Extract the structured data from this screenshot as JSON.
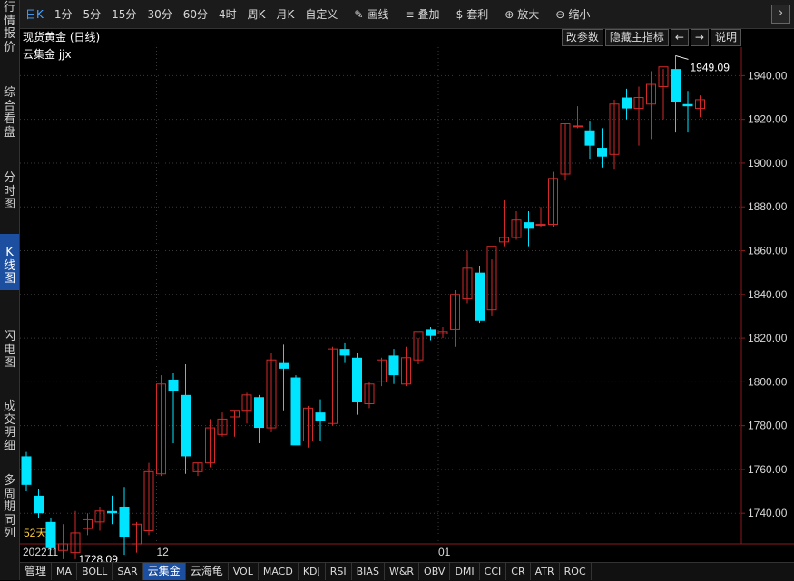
{
  "toolbar": {
    "items": [
      {
        "label": "日K",
        "icon": ""
      },
      {
        "label": "1分",
        "icon": ""
      },
      {
        "label": "5分",
        "icon": ""
      },
      {
        "label": "15分",
        "icon": ""
      },
      {
        "label": "30分",
        "icon": ""
      },
      {
        "label": "60分",
        "icon": ""
      },
      {
        "label": "4时",
        "icon": ""
      },
      {
        "label": "周K",
        "icon": ""
      },
      {
        "label": "月K",
        "icon": ""
      },
      {
        "label": "自定义",
        "icon": ""
      },
      {
        "label": "画线",
        "icon": "✎"
      },
      {
        "label": "叠加",
        "icon": "≡"
      },
      {
        "label": "套利",
        "icon": "$"
      },
      {
        "label": "放大",
        "icon": "⊕"
      },
      {
        "label": "缩小",
        "icon": "⊖"
      }
    ],
    "more_icon": "chevron-right-icon"
  },
  "sidebar": {
    "items": [
      {
        "label": "行情报价"
      },
      {
        "label": "综合看盘"
      },
      {
        "label": "分时图"
      },
      {
        "label": "K线图"
      },
      {
        "label": "闪电图"
      },
      {
        "label": "成交明细"
      },
      {
        "label": "多周期同列"
      }
    ]
  },
  "header": {
    "title": "现货黄金 (日线)",
    "subtitle": "云集金 jjx",
    "buttons": [
      {
        "label": "改参数"
      },
      {
        "label": "隐藏主指标"
      },
      {
        "label": "←"
      },
      {
        "label": "→"
      },
      {
        "label": "说明"
      }
    ]
  },
  "bottom_tabs": [
    {
      "label": "管理"
    },
    {
      "label": "MA"
    },
    {
      "label": "BOLL"
    },
    {
      "label": "SAR"
    },
    {
      "label": "云集金"
    },
    {
      "label": "云海龟"
    },
    {
      "label": "VOL"
    },
    {
      "label": "MACD"
    },
    {
      "label": "KDJ"
    },
    {
      "label": "RSI"
    },
    {
      "label": "BIAS"
    },
    {
      "label": "W&R"
    },
    {
      "label": "OBV"
    },
    {
      "label": "DMI"
    },
    {
      "label": "CCI"
    },
    {
      "label": "CR"
    },
    {
      "label": "ATR"
    },
    {
      "label": "ROC"
    }
  ],
  "colors": {
    "up": "#d42a2a",
    "down": "#00e5ff",
    "axis": "#8a1a1a",
    "grid": "#3a3a3a",
    "active": "#1d4fa0"
  },
  "chart_data": {
    "type": "candlestick",
    "ylim": [
      1726,
      1953
    ],
    "y_ticks": [
      1740,
      1760,
      1780,
      1800,
      1820,
      1840,
      1860,
      1880,
      1900,
      1920,
      1940
    ],
    "x_labels": [
      {
        "index": 0,
        "label": "202211"
      },
      {
        "index": 11,
        "label": "12"
      },
      {
        "index": 34,
        "label": "01"
      }
    ],
    "high_label": "1949.09",
    "low_label": "1728.09",
    "bars_label": "52天",
    "candles": [
      {
        "o": 1766,
        "h": 1768,
        "l": 1750,
        "c": 1753
      },
      {
        "o": 1748,
        "h": 1751,
        "l": 1738,
        "c": 1740
      },
      {
        "o": 1736,
        "h": 1738,
        "l": 1723,
        "c": 1724
      },
      {
        "o": 1723,
        "h": 1735,
        "l": 1719,
        "c": 1726
      },
      {
        "o": 1722,
        "h": 1741,
        "l": 1719,
        "c": 1731
      },
      {
        "o": 1733,
        "h": 1740,
        "l": 1730,
        "c": 1737
      },
      {
        "o": 1736,
        "h": 1743,
        "l": 1732,
        "c": 1741
      },
      {
        "o": 1741,
        "h": 1748,
        "l": 1735,
        "c": 1740
      },
      {
        "o": 1743,
        "h": 1752,
        "l": 1721,
        "c": 1729
      },
      {
        "o": 1726,
        "h": 1736,
        "l": 1722,
        "c": 1735
      },
      {
        "o": 1732,
        "h": 1763,
        "l": 1730,
        "c": 1759
      },
      {
        "o": 1758,
        "h": 1803,
        "l": 1757,
        "c": 1799
      },
      {
        "o": 1801,
        "h": 1804,
        "l": 1772,
        "c": 1796
      },
      {
        "o": 1794,
        "h": 1808,
        "l": 1758,
        "c": 1766
      },
      {
        "o": 1759,
        "h": 1763,
        "l": 1757,
        "c": 1763
      },
      {
        "o": 1763,
        "h": 1783,
        "l": 1761,
        "c": 1779
      },
      {
        "o": 1776,
        "h": 1786,
        "l": 1775,
        "c": 1783
      },
      {
        "o": 1784,
        "h": 1787,
        "l": 1775,
        "c": 1787
      },
      {
        "o": 1787,
        "h": 1795,
        "l": 1781,
        "c": 1794
      },
      {
        "o": 1793,
        "h": 1794,
        "l": 1772,
        "c": 1779
      },
      {
        "o": 1779,
        "h": 1813,
        "l": 1777,
        "c": 1810
      },
      {
        "o": 1809,
        "h": 1817,
        "l": 1787,
        "c": 1806
      },
      {
        "o": 1802,
        "h": 1803,
        "l": 1777,
        "c": 1771
      },
      {
        "o": 1773,
        "h": 1789,
        "l": 1770,
        "c": 1788
      },
      {
        "o": 1786,
        "h": 1792,
        "l": 1773,
        "c": 1782
      },
      {
        "o": 1781,
        "h": 1816,
        "l": 1780,
        "c": 1815
      },
      {
        "o": 1815,
        "h": 1818,
        "l": 1809,
        "c": 1812
      },
      {
        "o": 1811,
        "h": 1813,
        "l": 1785,
        "c": 1791
      },
      {
        "o": 1790,
        "h": 1800,
        "l": 1788,
        "c": 1799
      },
      {
        "o": 1800,
        "h": 1811,
        "l": 1798,
        "c": 1810
      },
      {
        "o": 1812,
        "h": 1815,
        "l": 1799,
        "c": 1803
      },
      {
        "o": 1799,
        "h": 1816,
        "l": 1798,
        "c": 1811
      },
      {
        "o": 1810,
        "h": 1820,
        "l": 1808,
        "c": 1823
      },
      {
        "o": 1824,
        "h": 1825,
        "l": 1819,
        "c": 1821
      },
      {
        "o": 1822,
        "h": 1825,
        "l": 1820,
        "c": 1823
      },
      {
        "o": 1824,
        "h": 1842,
        "l": 1816,
        "c": 1840
      },
      {
        "o": 1838,
        "h": 1860,
        "l": 1836,
        "c": 1852
      },
      {
        "o": 1850,
        "h": 1853,
        "l": 1827,
        "c": 1828
      },
      {
        "o": 1833,
        "h": 1856,
        "l": 1830,
        "c": 1862
      },
      {
        "o": 1864,
        "h": 1883,
        "l": 1862,
        "c": 1866
      },
      {
        "o": 1866,
        "h": 1878,
        "l": 1865,
        "c": 1874
      },
      {
        "o": 1873,
        "h": 1878,
        "l": 1862,
        "c": 1870
      },
      {
        "o": 1872,
        "h": 1880,
        "l": 1871,
        "c": 1872
      },
      {
        "o": 1872,
        "h": 1896,
        "l": 1871,
        "c": 1893
      },
      {
        "o": 1895,
        "h": 1918,
        "l": 1892,
        "c": 1918
      },
      {
        "o": 1917,
        "h": 1926,
        "l": 1916,
        "c": 1917
      },
      {
        "o": 1915,
        "h": 1919,
        "l": 1902,
        "c": 1908
      },
      {
        "o": 1907,
        "h": 1916,
        "l": 1898,
        "c": 1903
      },
      {
        "o": 1904,
        "h": 1929,
        "l": 1897,
        "c": 1927
      },
      {
        "o": 1930,
        "h": 1934,
        "l": 1920,
        "c": 1925
      },
      {
        "o": 1925,
        "h": 1935,
        "l": 1908,
        "c": 1930
      },
      {
        "o": 1927,
        "h": 1942,
        "l": 1911,
        "c": 1936
      },
      {
        "o": 1935,
        "h": 1943,
        "l": 1920,
        "c": 1944
      },
      {
        "o": 1943,
        "h": 1949.09,
        "l": 1914,
        "c": 1928
      },
      {
        "o": 1927,
        "h": 1933,
        "l": 1914,
        "c": 1926
      },
      {
        "o": 1925,
        "h": 1931,
        "l": 1921,
        "c": 1929
      }
    ]
  }
}
